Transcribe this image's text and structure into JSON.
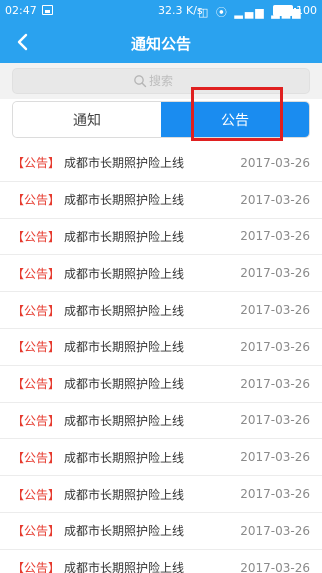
{
  "status_bar": {
    "time": "02:47",
    "speed": "32.3 K/s",
    "icons": "◫ ⦿ ▂▄▆ ▂▄▆",
    "battery": "100"
  },
  "nav": {
    "title": "通知公告"
  },
  "search": {
    "placeholder": "搜索"
  },
  "tabs": [
    {
      "label": "通知",
      "active": false
    },
    {
      "label": "公告",
      "active": true
    }
  ],
  "list": [
    {
      "tag": "【公告】",
      "title": "成都市长期照护险上线",
      "date": "2017-03-26"
    },
    {
      "tag": "【公告】",
      "title": "成都市长期照护险上线",
      "date": "2017-03-26"
    },
    {
      "tag": "【公告】",
      "title": "成都市长期照护险上线",
      "date": "2017-03-26"
    },
    {
      "tag": "【公告】",
      "title": "成都市长期照护险上线",
      "date": "2017-03-26"
    },
    {
      "tag": "【公告】",
      "title": "成都市长期照护险上线",
      "date": "2017-03-26"
    },
    {
      "tag": "【公告】",
      "title": "成都市长期照护险上线",
      "date": "2017-03-26"
    },
    {
      "tag": "【公告】",
      "title": "成都市长期照护险上线",
      "date": "2017-03-26"
    },
    {
      "tag": "【公告】",
      "title": "成都市长期照护险上线",
      "date": "2017-03-26"
    },
    {
      "tag": "【公告】",
      "title": "成都市长期照护险上线",
      "date": "2017-03-26"
    },
    {
      "tag": "【公告】",
      "title": "成都市长期照护险上线",
      "date": "2017-03-26"
    },
    {
      "tag": "【公告】",
      "title": "成都市长期照护险上线",
      "date": "2017-03-26"
    },
    {
      "tag": "【公告】",
      "title": "成都市长期照护险上线",
      "date": "2017-03-26"
    }
  ],
  "colors": {
    "primary": "#2aa2ef",
    "tab_active": "#1a8cf0",
    "tag_red": "#e63a2e",
    "highlight": "#e02020"
  }
}
